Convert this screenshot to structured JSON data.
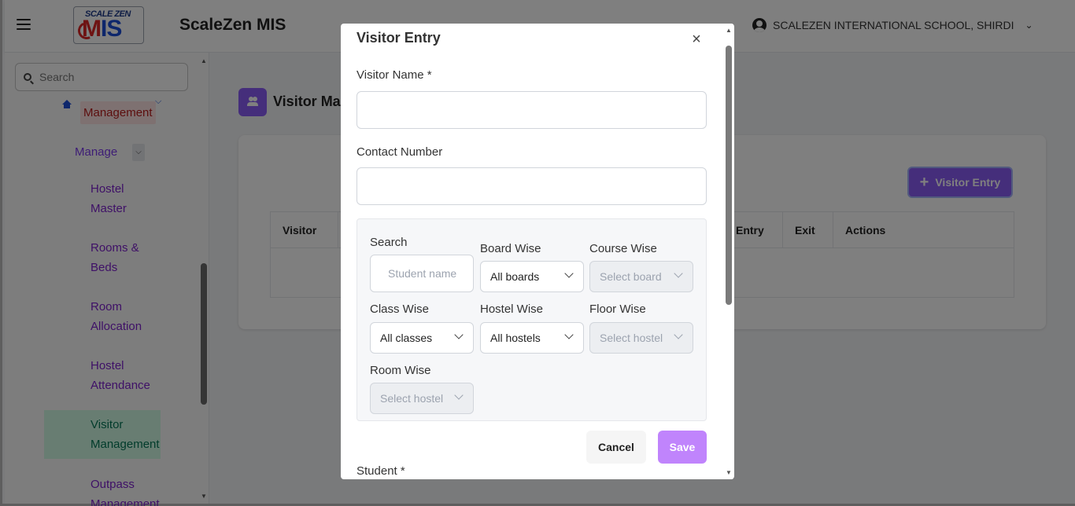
{
  "header": {
    "logo_top": "SCALE ZEN",
    "logo_main_a": "M",
    "logo_main_b": "IS",
    "app_title": "ScaleZen MIS",
    "school_name": "SCALEZEN INTERNATIONAL SCHOOL, SHIRDI"
  },
  "sidebar": {
    "search_placeholder": "Search",
    "section": "Management",
    "manage": "Manage",
    "items": [
      {
        "label": "Hostel Master"
      },
      {
        "label": "Rooms & Beds"
      },
      {
        "label": "Room Allocation"
      },
      {
        "label": "Hostel Attendance"
      },
      {
        "label": "Visitor Management"
      },
      {
        "label": "Outpass Management"
      }
    ]
  },
  "main": {
    "page_title": "Visitor Mar",
    "add_button": "Visitor Entry",
    "columns": [
      "Visitor",
      "Entry",
      "Exit",
      "Actions"
    ]
  },
  "modal": {
    "title": "Visitor Entry",
    "visitor_name_label": "Visitor Name *",
    "contact_label": "Contact Number",
    "filters": {
      "search_label": "Search",
      "search_placeholder": "Student name",
      "board_label": "Board Wise",
      "board_value": "All boards",
      "course_label": "Course Wise",
      "course_value": "Select board",
      "class_label": "Class Wise",
      "class_value": "All classes",
      "hostel_label": "Hostel Wise",
      "hostel_value": "All hostels",
      "floor_label": "Floor Wise",
      "floor_value": "Select hostel",
      "room_label": "Room Wise",
      "room_value": "Select hostel"
    },
    "student_label": "Student *",
    "cancel": "Cancel",
    "save": "Save"
  },
  "colors": {
    "accent": "#8b5cf6",
    "save": "#c084fc",
    "danger": "#b91c1c",
    "active_nav": "#047857"
  }
}
